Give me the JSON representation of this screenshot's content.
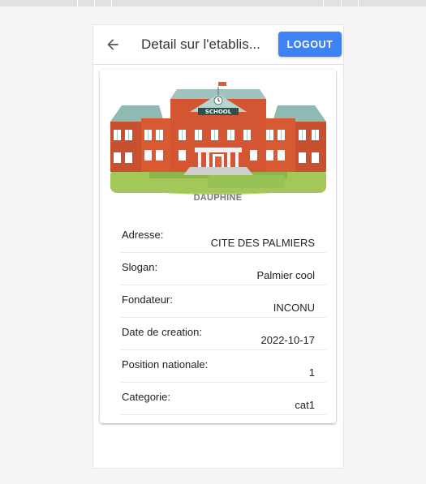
{
  "header": {
    "title": "Detail sur l'etablis...",
    "logout_label": "LOGOUT",
    "accent_color": "#3e82f7"
  },
  "school": {
    "sign_text": "SCHOOL",
    "name": "DAUPHINE"
  },
  "details": [
    {
      "label": "Adresse:",
      "value": "CITE DES PALMIERS"
    },
    {
      "label": "Slogan:",
      "value": "Palmier cool"
    },
    {
      "label": "Fondateur:",
      "value": "INCONU"
    },
    {
      "label": "Date de creation:",
      "value": "2022-10-17"
    },
    {
      "label": "Position nationale:",
      "value": "1"
    },
    {
      "label": "Categorie:",
      "value": "cat1"
    }
  ],
  "icons": {
    "back": "arrow-left-icon"
  }
}
